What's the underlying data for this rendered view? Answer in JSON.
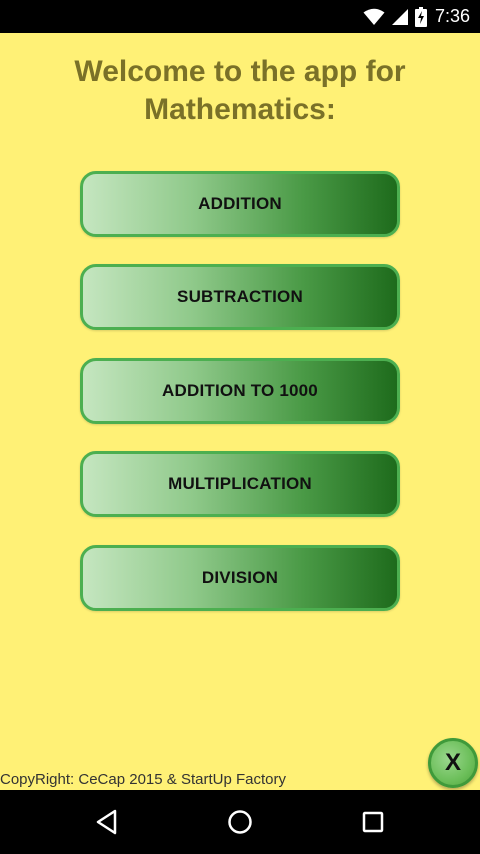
{
  "status_bar": {
    "time": "7:36",
    "icons": [
      "wifi-icon",
      "cell-signal-icon",
      "battery-charging-icon"
    ]
  },
  "app": {
    "title": "Welcome to the app for\nMathematics:",
    "buttons": [
      {
        "label": "ADDITION"
      },
      {
        "label": "SUBTRACTION"
      },
      {
        "label": "ADDITION TO 1000"
      },
      {
        "label": "MULTIPLICATION"
      },
      {
        "label": "DIVISION"
      }
    ],
    "copyright": "CopyRight: CeCap 2015 & StartUp Factory",
    "close_label": "X"
  },
  "nav_bar": {
    "icons": [
      "back-icon",
      "home-icon",
      "recents-icon"
    ]
  },
  "colors": {
    "background": "#fff176",
    "title": "#7a7128",
    "button_border": "#4caf50",
    "button_dark": "#1e6b1c",
    "button_light": "#c5e6c0"
  }
}
